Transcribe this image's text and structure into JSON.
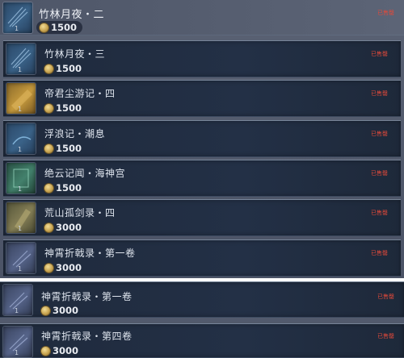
{
  "currency_icon": "coin-icon",
  "colors": {
    "sold_out_text": "#e34a3a",
    "row_background": "#1f2a3c",
    "panel_background": "#555d70"
  },
  "items": [
    {
      "title": "竹林月夜・二",
      "price": "1500",
      "status": "已售罄",
      "qty": "1",
      "cover_icon": "bamboo-book-icon"
    },
    {
      "title": "竹林月夜・三",
      "price": "1500",
      "status": "已售罄",
      "qty": "1",
      "cover_icon": "bamboo-book-icon"
    },
    {
      "title": "帝君尘游记・四",
      "price": "1500",
      "status": "已售罄",
      "qty": "1",
      "cover_icon": "golden-book-icon"
    },
    {
      "title": "浮浪记・潮息",
      "price": "1500",
      "status": "已售罄",
      "qty": "1",
      "cover_icon": "blue-book-icon"
    },
    {
      "title": "绝云记闻・海神宫",
      "price": "1500",
      "status": "已售罄",
      "qty": "1",
      "cover_icon": "teal-book-icon"
    },
    {
      "title": "荒山孤剑录・四",
      "price": "3000",
      "status": "已售罄",
      "qty": "1",
      "cover_icon": "olive-book-icon"
    },
    {
      "title": "神霄折戟录・第一卷",
      "price": "3000",
      "status": "已售罄",
      "qty": "1",
      "cover_icon": "slate-book-icon"
    }
  ],
  "items_lower": [
    {
      "title": "神霄折戟录・第一卷",
      "price": "3000",
      "status": "已售罄",
      "qty": "1",
      "cover_icon": "slate-book-icon"
    },
    {
      "title": "神霄折戟录・第四卷",
      "price": "3000",
      "status": "已售罄",
      "qty": "1",
      "cover_icon": "slate-book-icon"
    }
  ]
}
